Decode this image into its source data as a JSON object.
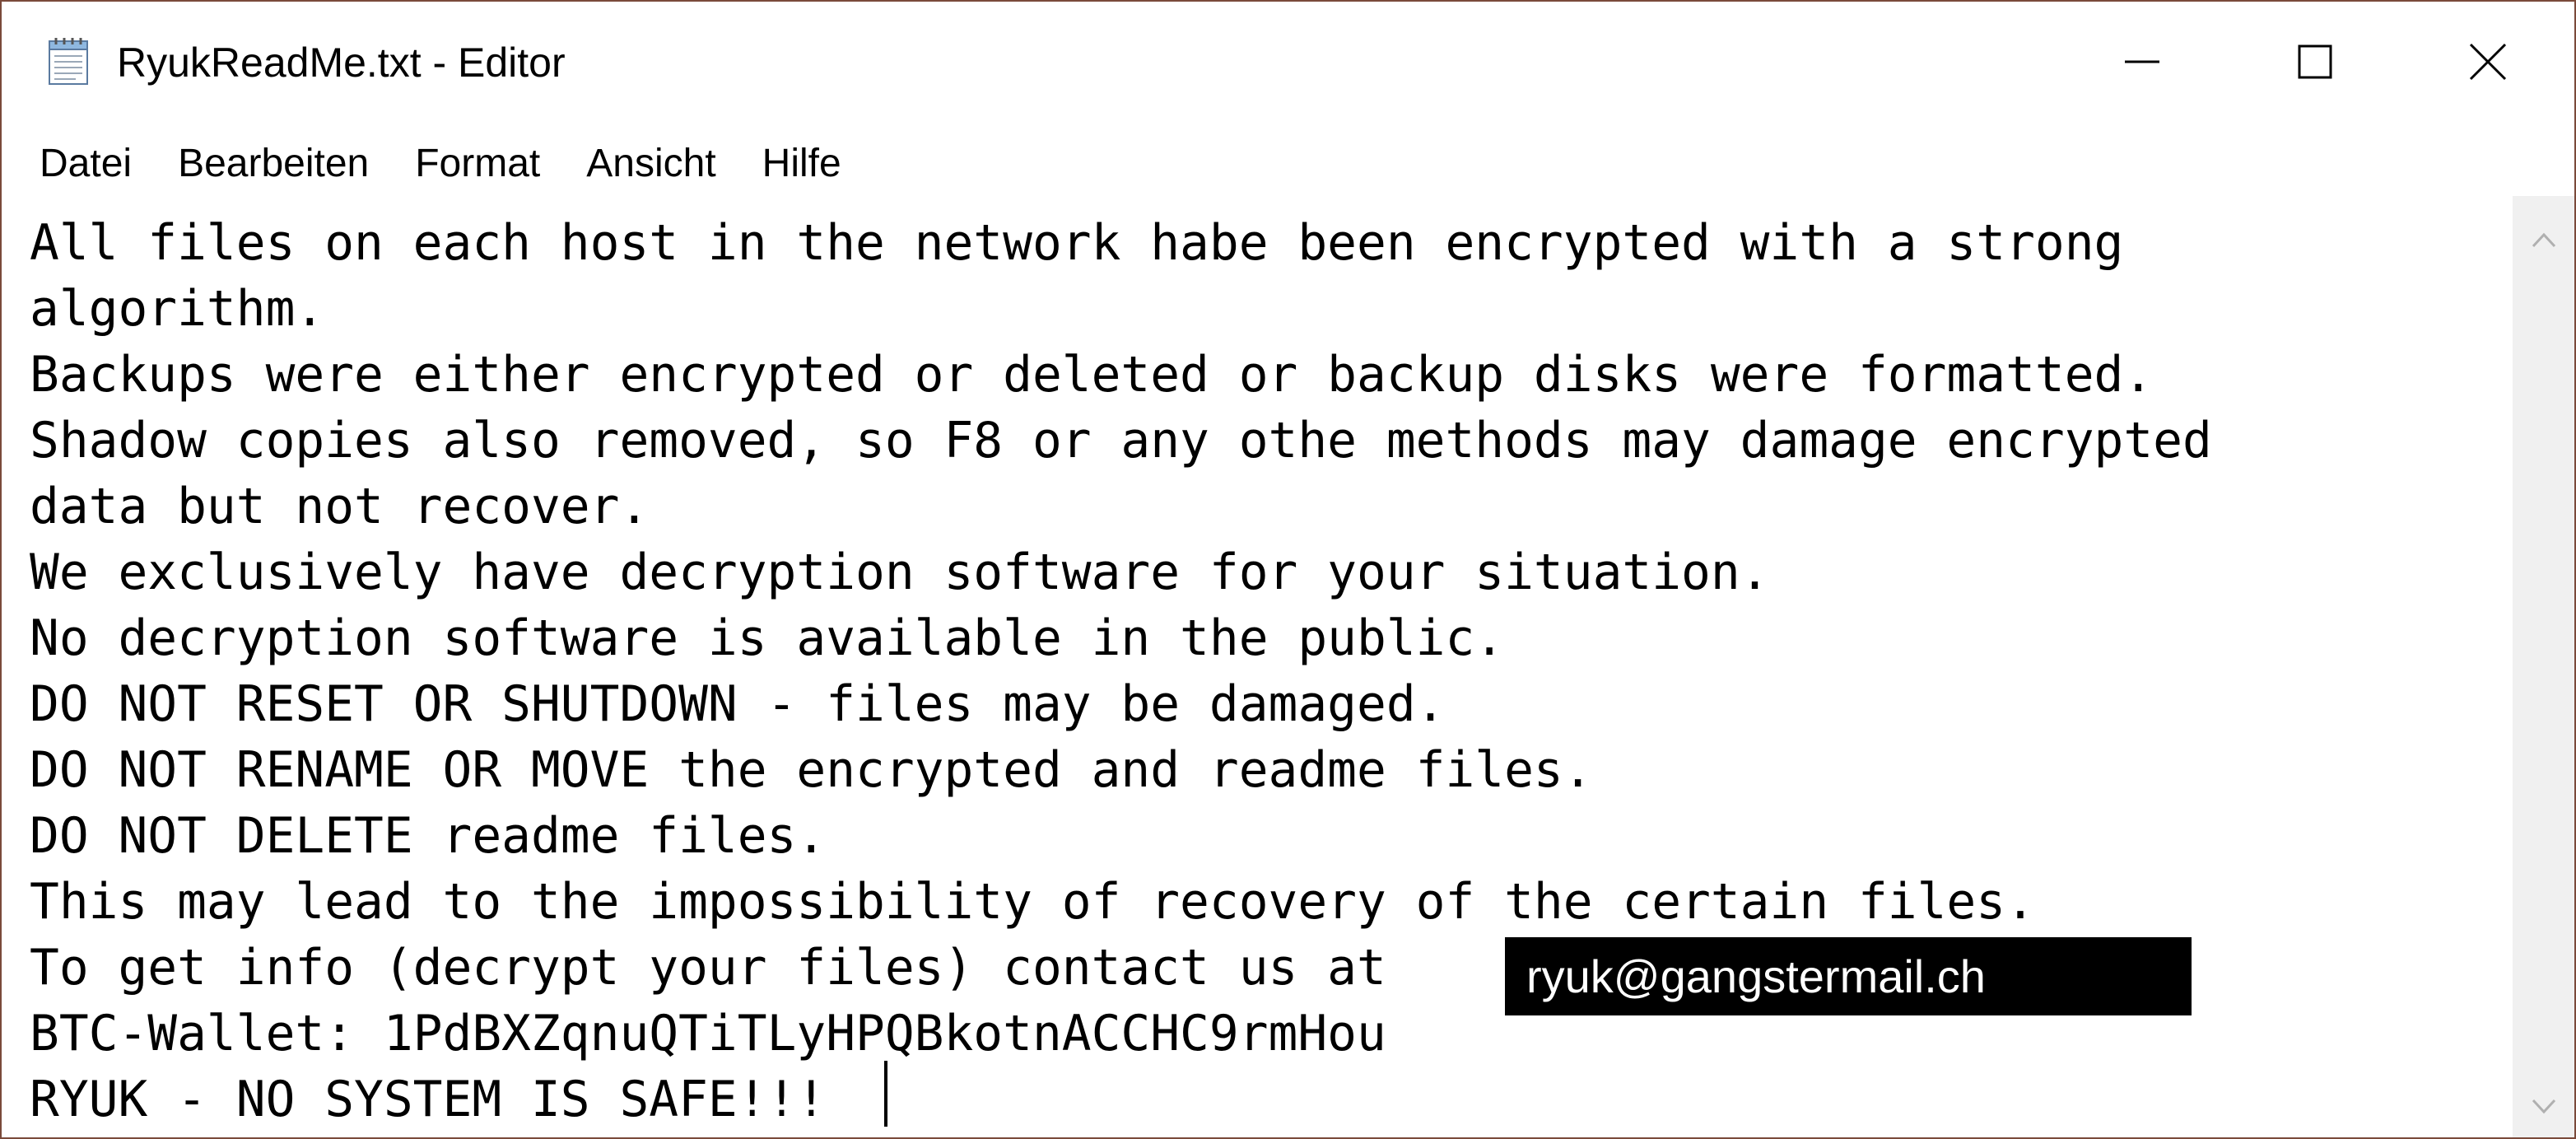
{
  "window": {
    "title": "RyukReadMe.txt - Editor",
    "app_icon": "notepad-icon",
    "controls": [
      "minimize-icon",
      "maximize-icon",
      "close-icon"
    ]
  },
  "menu": {
    "items": [
      "Datei",
      "Bearbeiten",
      "Format",
      "Ansicht",
      "Hilfe"
    ]
  },
  "document": {
    "lines": [
      "All files on each host in the network habe been encrypted with a strong",
      "algorithm.",
      "Backups were either encrypted or deleted or backup disks were formatted.",
      "Shadow copies also removed, so F8 or any othe methods may damage encrypted",
      "data but not recover.",
      "We exclusively have decryption software for your situation.",
      "No decryption software is available in the public.",
      "DO NOT RESET OR SHUTDOWN - files may be damaged.",
      "DO NOT RENAME OR MOVE the encrypted and readme files.",
      "DO NOT DELETE readme files.",
      "This may lead to the impossibility of recovery of the certain files.",
      "To get info (decrypt your files) contact us at",
      "BTC-Wallet: 1PdBXZqnuQTiTLyHPQBkotnACCHC9rmHou",
      "RYUK - NO SYSTEM IS SAFE!!!"
    ],
    "redacted_email": "ryuk@gangstermail.ch"
  },
  "colors": {
    "window_border": "#7a4a3a",
    "redaction_bg": "#000000",
    "scrollbar_bg": "#f0f0f0"
  }
}
